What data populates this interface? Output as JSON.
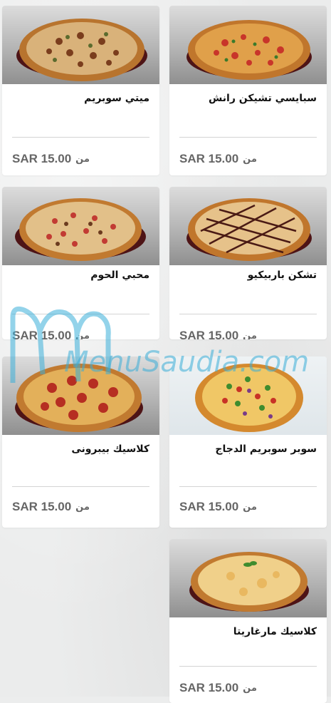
{
  "menu_items": [
    {
      "name": "ميتي سوبريم",
      "price": "SAR 15.00",
      "from": "من"
    },
    {
      "name": "سبايسي تشيكن رانش",
      "price": "SAR 15.00",
      "from": "من"
    },
    {
      "name": "محبي الحوم",
      "price": "SAR 15.00",
      "from": "من"
    },
    {
      "name": "تشكن باربيكيو",
      "price": "SAR 15.00",
      "from": "من"
    },
    {
      "name": "كلاسيك بيبرونى",
      "price": "SAR 15.00",
      "from": "من"
    },
    {
      "name": "سوبر سوبريم الدجاج",
      "price": "SAR 15.00",
      "from": "من"
    },
    {
      "name": "كلاسيك مارغاريتا",
      "price": "SAR 15.00",
      "from": "من"
    }
  ],
  "watermark": {
    "text": "MenuSaudia.com"
  },
  "colors": {
    "accent": "#3aaed8",
    "price_text": "#666666",
    "card_bg": "#ffffff"
  }
}
